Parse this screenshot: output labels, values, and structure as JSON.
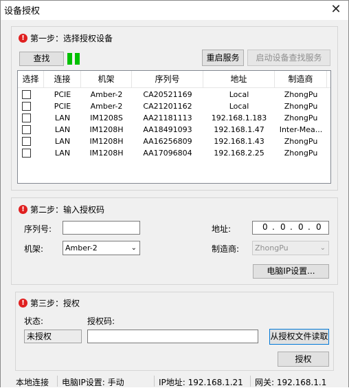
{
  "window": {
    "title": "设备授权",
    "close_glyph": "✕"
  },
  "step1": {
    "title": "第一步：选择授权设备",
    "search_label": "查找",
    "restart_label": "重启服务",
    "start_service_label": "启动设备查找服务",
    "columns": [
      "选择",
      "连接",
      "机架",
      "序列号",
      "地址",
      "制造商"
    ],
    "rows": [
      {
        "connection": "PCIE",
        "chassis": "Amber-2",
        "serial": "CA20521169",
        "address": "Local",
        "vendor": "ZhongPu"
      },
      {
        "connection": "PCIE",
        "chassis": "Amber-2",
        "serial": "CA21201162",
        "address": "Local",
        "vendor": "ZhongPu"
      },
      {
        "connection": "LAN",
        "chassis": "IM1208S",
        "serial": "AA21181113",
        "address": "192.168.1.183",
        "vendor": "ZhongPu"
      },
      {
        "connection": "LAN",
        "chassis": "IM1208H",
        "serial": "AA18491093",
        "address": "192.168.1.47",
        "vendor": "Inter-Mea..."
      },
      {
        "connection": "LAN",
        "chassis": "IM1208H",
        "serial": "AA16256809",
        "address": "192.168.1.43",
        "vendor": "ZhongPu"
      },
      {
        "connection": "LAN",
        "chassis": "IM1208H",
        "serial": "AA17096804",
        "address": "192.168.2.25",
        "vendor": "ZhongPu"
      }
    ]
  },
  "step2": {
    "title": "第二步：输入授权码",
    "serial_label": "序列号:",
    "serial_value": "",
    "address_label": "地址:",
    "ip": [
      "0",
      "0",
      "0",
      "0"
    ],
    "chassis_label": "机架:",
    "chassis_value": "Amber-2",
    "vendor_label": "制造商:",
    "vendor_value": "ZhongPu",
    "pc_ip_button": "电脑IP设置..."
  },
  "step3": {
    "title": "第三步：授权",
    "status_label": "状态:",
    "status_value": "未授权",
    "code_label": "授权码:",
    "code_value": "",
    "read_file_button": "从授权文件读取",
    "authorize_button": "授权"
  },
  "statusbar": {
    "connection": "本地连接",
    "pc_ip_mode": "电脑IP设置: 手动",
    "ip_address": "IP地址: 192.168.1.21",
    "gateway": "网关: 192.168.1.1"
  },
  "colors": {
    "alert": "#e02020",
    "indicator": "#00c000",
    "focus": "#0078d7"
  },
  "icons": {
    "step": "error-circle-icon",
    "close": "close-icon",
    "dropdown": "chevron-down-icon"
  }
}
